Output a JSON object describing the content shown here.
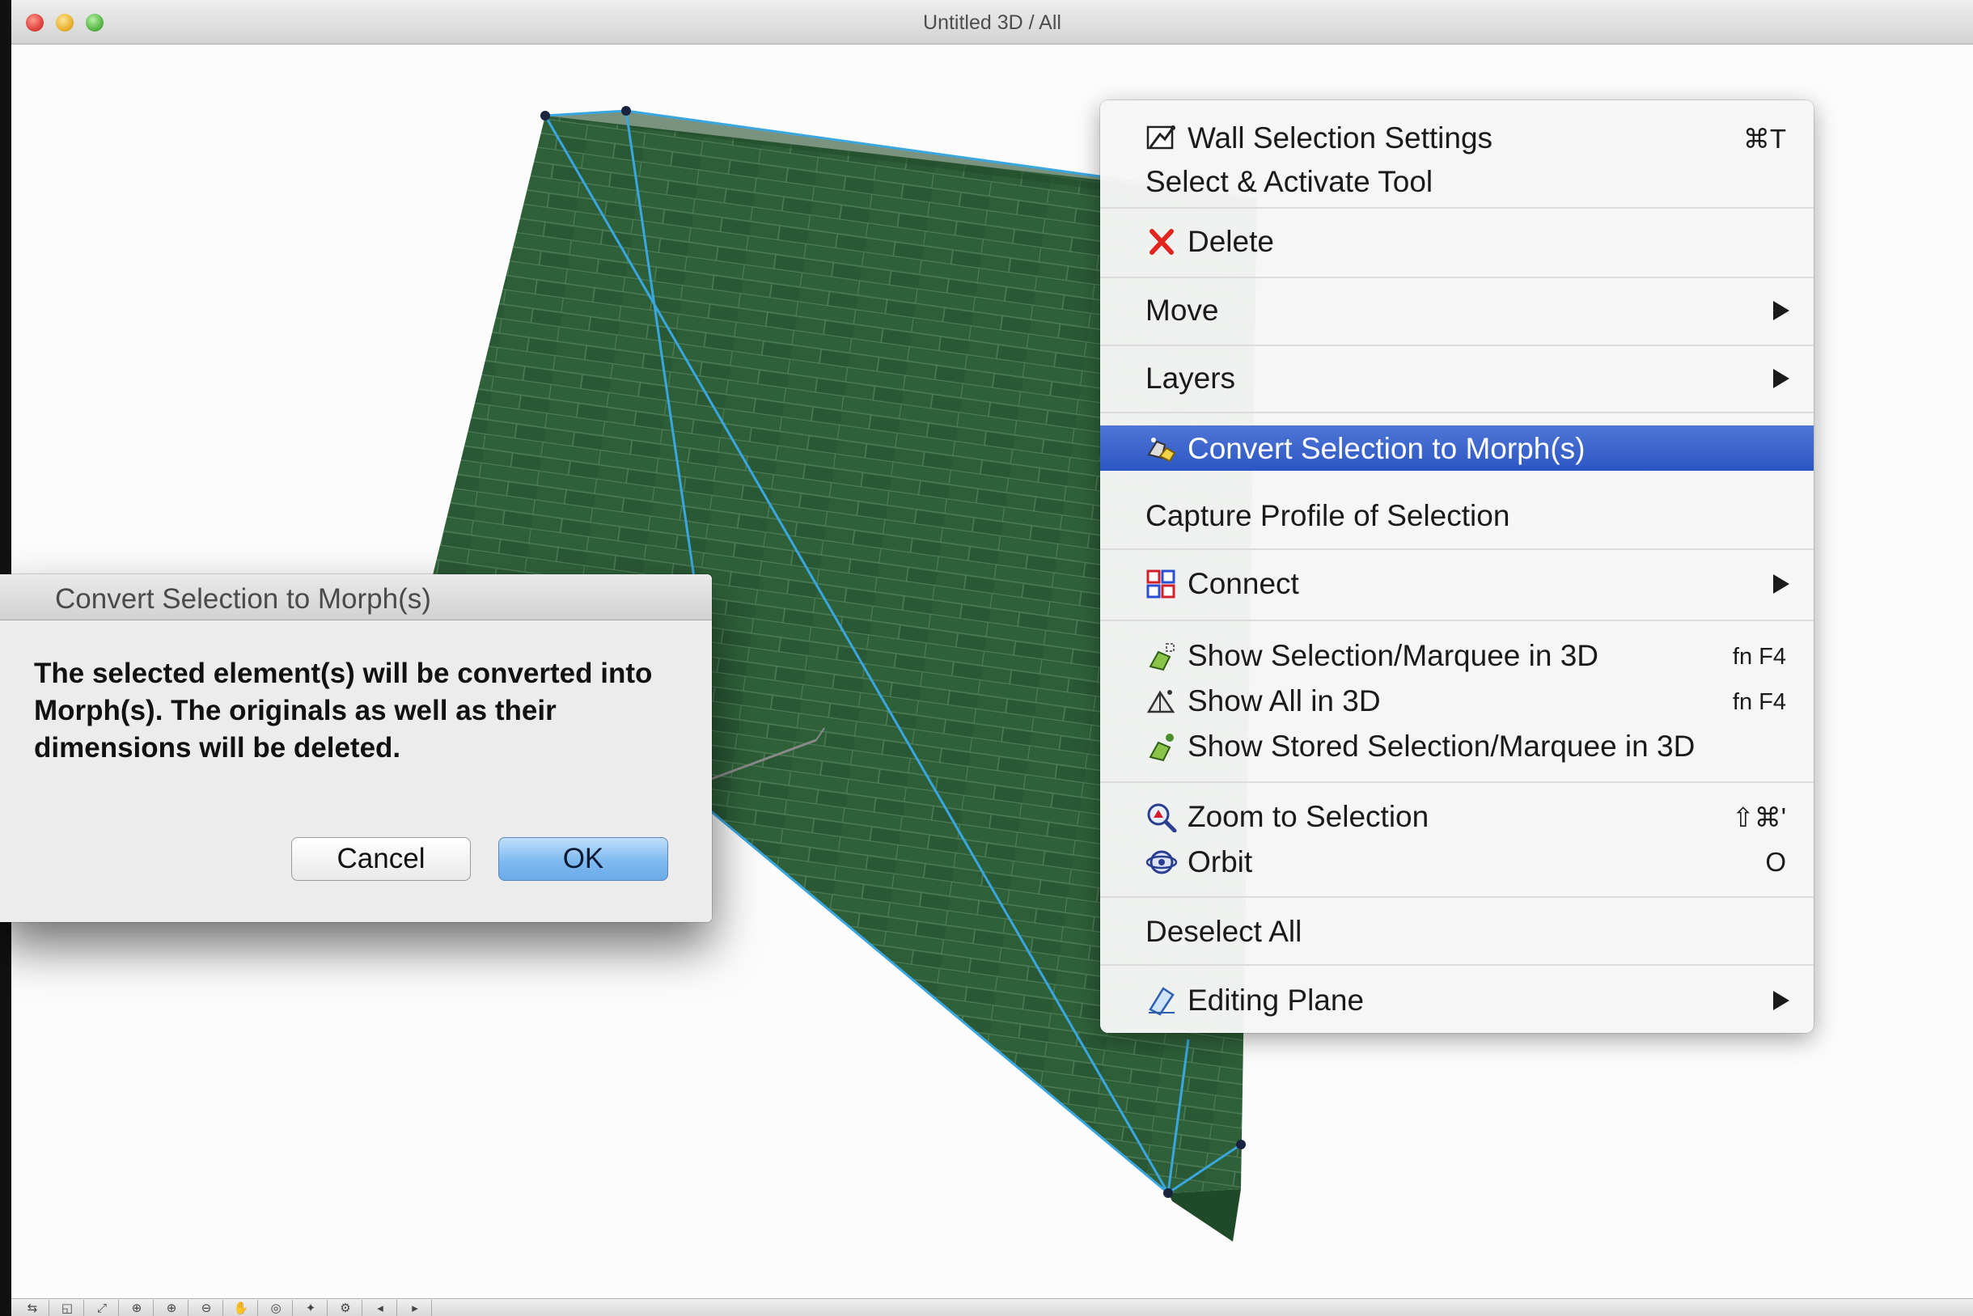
{
  "window": {
    "title": "Untitled 3D / All"
  },
  "context_menu": {
    "items": [
      {
        "label": "Wall Selection Settings",
        "shortcut": "⌘T",
        "icon": "wall-settings-icon"
      },
      {
        "label": "Select & Activate Tool"
      },
      {
        "label": "Delete",
        "icon": "delete-x-icon"
      },
      {
        "label": "Move",
        "submenu": true
      },
      {
        "label": "Layers",
        "submenu": true
      },
      {
        "label": "Convert Selection to Morph(s)",
        "icon": "morph-icon",
        "highlighted": true
      },
      {
        "label": "Capture Profile of Selection"
      },
      {
        "label": "Connect",
        "icon": "connect-icon",
        "submenu": true
      },
      {
        "label": "Show Selection/Marquee in 3D",
        "shortcut": "fn F4",
        "icon": "show-selection-3d-icon"
      },
      {
        "label": "Show All in 3D",
        "shortcut": "fn F4",
        "icon": "show-all-3d-icon"
      },
      {
        "label": "Show Stored Selection/Marquee in 3D",
        "icon": "show-stored-3d-icon"
      },
      {
        "label": "Zoom to Selection",
        "shortcut": "⇧⌘'",
        "icon": "zoom-selection-icon"
      },
      {
        "label": "Orbit",
        "shortcut": "O",
        "icon": "orbit-icon"
      },
      {
        "label": "Deselect All"
      },
      {
        "label": "Editing Plane",
        "icon": "editing-plane-icon",
        "submenu": true
      }
    ]
  },
  "dialog": {
    "title": "Convert Selection to Morph(s)",
    "message": "The selected element(s) will be converted into Morph(s). The originals as well as their dimensions will be deleted.",
    "cancel_label": "Cancel",
    "ok_label": "OK"
  },
  "colors": {
    "menu_highlight": "#3a64cc",
    "wall": "#2a5a35",
    "selection_edge": "#3aa6e0",
    "ok_button": "#7fbaf1"
  }
}
